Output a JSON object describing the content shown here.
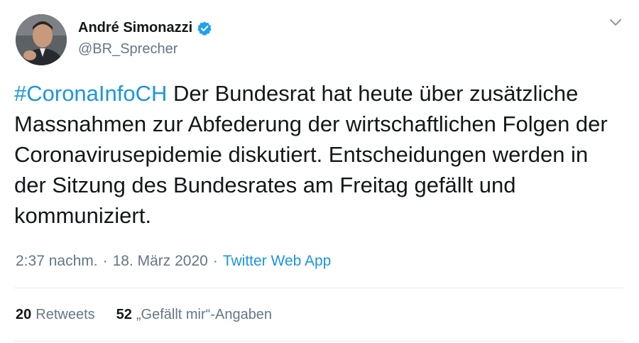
{
  "author": {
    "display_name": "André Simonazzi",
    "handle": "@BR_Sprecher",
    "verified": true
  },
  "tweet": {
    "hashtag": "#CoronaInfoCH",
    "text": " Der Bundesrat hat heute über zusätzliche Massnahmen zur Abfederung der wirtschaftlichen Folgen der Coronavirusepidemie diskutiert. Entscheidungen werden in der Sitzung des Bundesrates am Freitag gefällt und kommuniziert."
  },
  "meta": {
    "time": "2:37 nachm.",
    "separator": "·",
    "date": "18. März 2020",
    "source": "Twitter Web App"
  },
  "stats": {
    "retweets_count": "20",
    "retweets_label": "Retweets",
    "likes_count": "52",
    "likes_label": "„Gefällt mir“-Angaben"
  },
  "colors": {
    "link": "#1b95e0",
    "muted": "#657786",
    "text": "#14171a"
  },
  "icons": {
    "verified": "verified-badge-icon",
    "caret": "chevron-down-icon"
  }
}
